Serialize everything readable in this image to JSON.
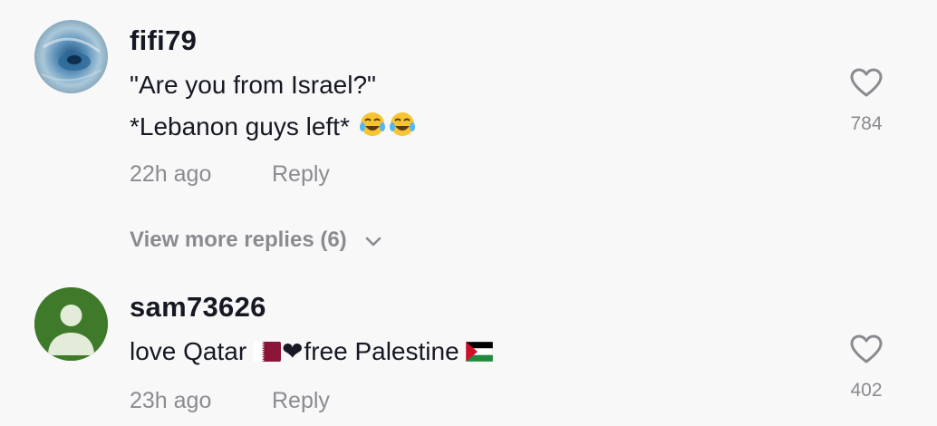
{
  "comments": [
    {
      "username": "fifi79",
      "line1": "\"Are you from Israel?\"",
      "line2": "*Lebanon guys left*",
      "line2_emoji": "😂😂",
      "timestamp": "22h ago",
      "reply_label": "Reply",
      "likes": "784"
    },
    {
      "username": "sam73626",
      "text_a": "love Qatar ",
      "text_heart": "❤",
      "text_b": "free Palestine ",
      "timestamp": "23h ago",
      "reply_label": "Reply",
      "likes": "402"
    }
  ],
  "view_more": {
    "label": "View more replies (6)"
  },
  "icons": {
    "like": "heart-outline-icon",
    "expand": "chevron-down-icon",
    "default_avatar": "person-silhouette-icon"
  },
  "colors": {
    "background": "#f8f8f8",
    "primary_text": "#161823",
    "secondary_text": "#8a8b91",
    "default_avatar_bg": "#3f7a2a"
  }
}
